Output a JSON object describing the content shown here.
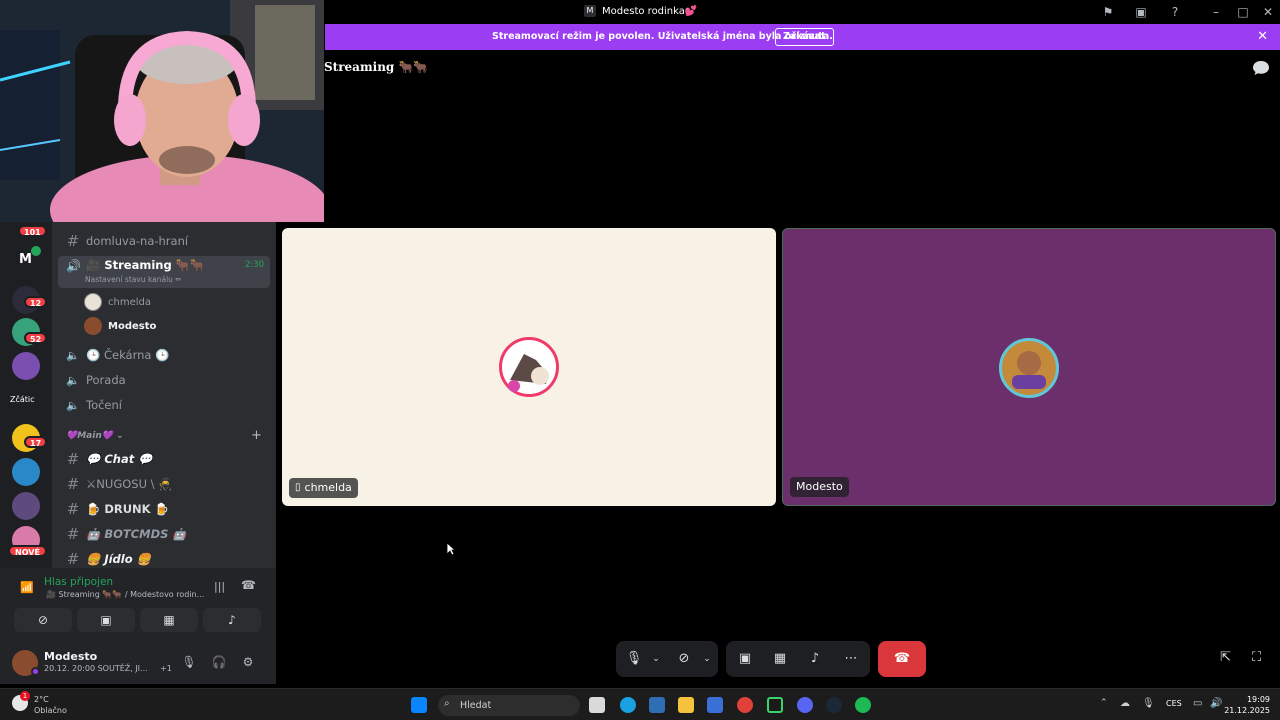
{
  "window": {
    "title": "Modesto rodinka💕",
    "server_icon_letter": "M"
  },
  "banner": {
    "text": "Streamovací režim je povolen. Uživatelská jména byla oříznuta.",
    "button_label": "Zakázat",
    "close_glyph": "✕"
  },
  "header": {
    "channel_title": "Streaming 🐂🐂"
  },
  "rail": {
    "badges": {
      "top": "101",
      "g1": "12",
      "g2": "52",
      "g3": "17"
    },
    "text_guild": "Zčátic",
    "new_label": "NOVÉ"
  },
  "channels": {
    "domluva": "domluva-na-hraní",
    "streaming": "🎥 Streaming 🐂🐂",
    "streaming_timer": "2:30",
    "streaming_sub": "Nastavení stavu kanálu ✏",
    "voice_users": [
      "chmelda",
      "Modesto"
    ],
    "cekarna": "🕒 Čekárna 🕒",
    "porada": "Porada",
    "toceni": "Točení",
    "category": "💜Main💜",
    "add_glyph": "+",
    "chat": "💬 Chat 💬",
    "nugosu": "⚔NUGOSU \\ 🥷",
    "drunk": "🍺 DRUNK 🍺",
    "botcmds": "🤖 BOTCMDS 🤖",
    "jidlo": "🍔 Jídlo 🍔"
  },
  "voice_panel": {
    "status": "Hlas připojen",
    "sub": "🎥 Streaming 🐂🐂 / Modestovo rodin...",
    "user_name": "Modesto",
    "user_status": "20.12. 20:00 SOUTĚŽ, JI...",
    "plus_count": "+1"
  },
  "tiles": [
    {
      "label": "chmelda",
      "bg": "#f7f1e6"
    },
    {
      "label": "Modesto",
      "bg": "#6b2f6c"
    }
  ],
  "taskbar": {
    "search_placeholder": "Hledat",
    "weather_temp": "2°C",
    "weather_desc": "Oblačno",
    "weather_badge": "1",
    "lang": "CES",
    "time": "19:09",
    "date": "21.12.2025"
  },
  "colors": {
    "accent": "#9b3df3",
    "danger": "#da373c",
    "online": "#23a55a"
  }
}
